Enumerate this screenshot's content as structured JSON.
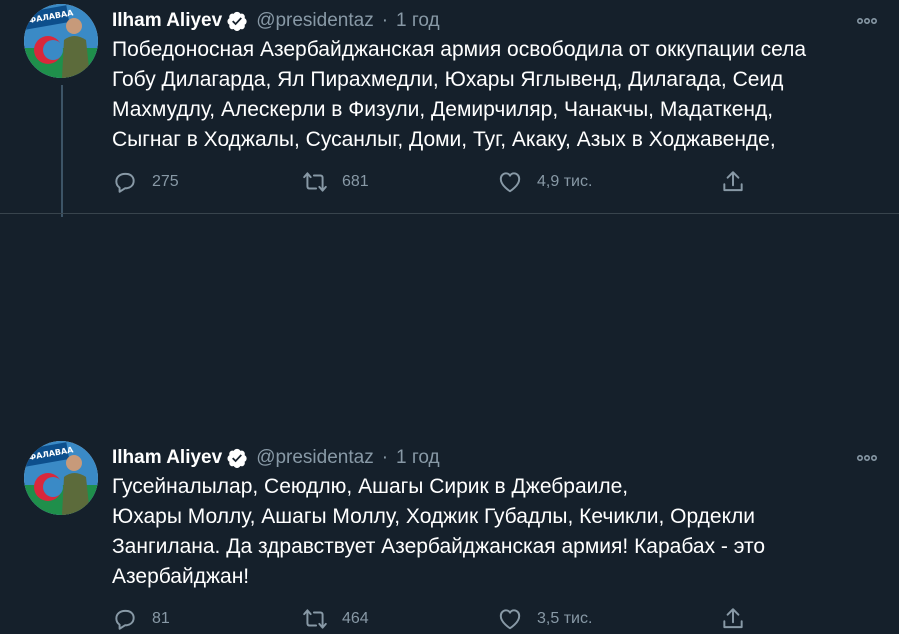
{
  "tweets": [
    {
      "author_name": "Ilham Aliyev",
      "handle": "@presidentaz",
      "separator": "·",
      "time": "1 год",
      "text": "Победоносная Азербайджанская армия освободила от оккупации села\nГобу Дилагарда,  Ял Пирахмедли, Юхары Яглывенд, Дилагада, Сеид\nМахмудлу, Алескерли в Физули,  Демирчиляр, Чанакчы, Мадаткенд,\nСыгнаг  в Ходжалы,  Сусанлыг, Доми, Туг,  Акаку, Азых в Ходжавенде,",
      "replies": "275",
      "retweets": "681",
      "likes": "4,9 тис."
    },
    {
      "author_name": "Ilham Aliyev",
      "handle": "@presidentaz",
      "separator": "·",
      "time": "1 год",
      "text": "Гусейналылар, Сеюдлю, Ашагы Сирик в Джебраиле,\nЮхары Моллу, Ашагы Моллу, Ходжик Губадлы, Кечикли, Ордекли\nЗангилана. Да здравствует Азербайджанская армия! Карабах - это\nАзербайджан!",
      "replies": "81",
      "retweets": "464",
      "likes": "3,5 тис."
    }
  ],
  "avatar_text": "ФАЛАВАА",
  "icons": [
    "verified-icon",
    "more-icon",
    "reply-icon",
    "retweet-icon",
    "like-icon",
    "share-icon"
  ],
  "colors": {
    "background": "#15202b",
    "muted": "#8899a6",
    "verified": "#ffffff",
    "divider": "#38444d"
  }
}
